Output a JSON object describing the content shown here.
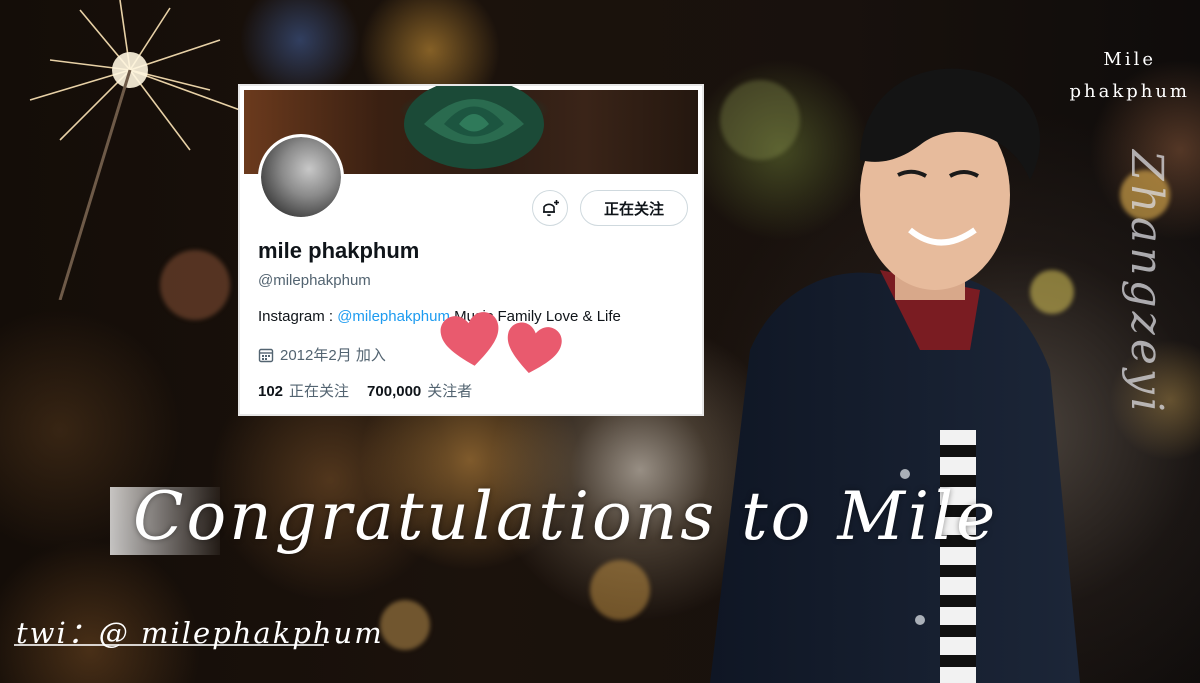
{
  "profile": {
    "display_name": "mile phakphum",
    "handle": "@milephakphum",
    "bio_prefix": "Instagram : ",
    "bio_link": "@milephakphum",
    "bio_suffix": " Music Family Love & Life",
    "joined": "2012年2月 加入",
    "following_count": "102",
    "following_label": "正在关注",
    "followers_count": "700,000",
    "followers_label": "关注者",
    "follow_button": "正在关注"
  },
  "overlay": {
    "side_name_line1": "Mile",
    "side_name_line2": "phakphum",
    "vertical_text": "Zhangzeyi",
    "congrats": "Congratulations  to  Mile",
    "twi": "twi：@  milephakphum"
  },
  "icons": {
    "bell": "bell-plus-icon",
    "calendar": "calendar-icon",
    "heart": "heart-icon"
  },
  "colors": {
    "link": "#1d9bf0",
    "heart": "#e95a6e",
    "banner_rose": "#1f5d45"
  }
}
